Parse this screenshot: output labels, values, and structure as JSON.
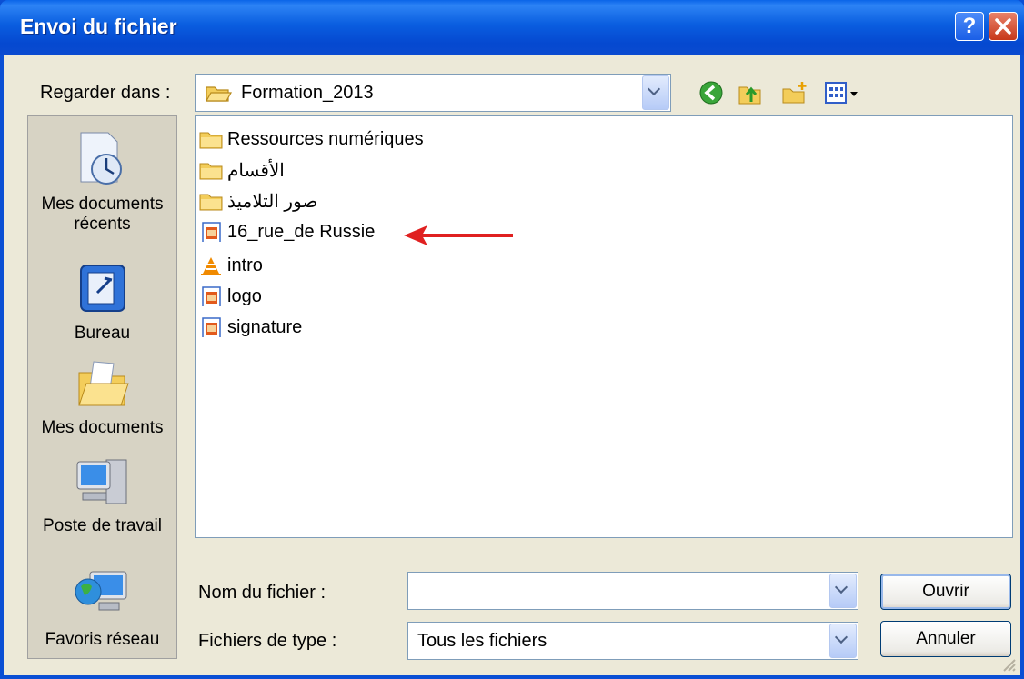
{
  "window": {
    "title": "Envoi du fichier"
  },
  "lookin": {
    "label": "Regarder dans :",
    "value": "Formation_2013"
  },
  "places": [
    {
      "label_lines": [
        "Mes documents",
        "récents"
      ]
    },
    {
      "label_lines": [
        "Bureau"
      ]
    },
    {
      "label_lines": [
        "Mes documents"
      ]
    },
    {
      "label_lines": [
        "Poste de travail"
      ]
    },
    {
      "label_lines": [
        "Favoris réseau"
      ]
    }
  ],
  "files": [
    {
      "name": "Ressources numériques",
      "icon": "folder-icon"
    },
    {
      "name": "الأقسام",
      "icon": "folder-icon"
    },
    {
      "name": "صور التلاميذ",
      "icon": "folder-icon"
    },
    {
      "name": "16_rue_de Russie",
      "icon": "video-file-icon"
    },
    {
      "name": "intro",
      "icon": "vlc-cone-icon"
    },
    {
      "name": "logo",
      "icon": "video-file-icon"
    },
    {
      "name": "signature",
      "icon": "video-file-icon"
    }
  ],
  "filename": {
    "label": "Nom du fichier :",
    "value": ""
  },
  "filetype": {
    "label": "Fichiers de type :",
    "value": "Tous les fichiers"
  },
  "buttons": {
    "open": "Ouvrir",
    "cancel": "Annuler"
  },
  "colors": {
    "title_bar": "#0a5ee0",
    "arrow": "#e02020",
    "dialog_bg": "#ece9d8"
  }
}
